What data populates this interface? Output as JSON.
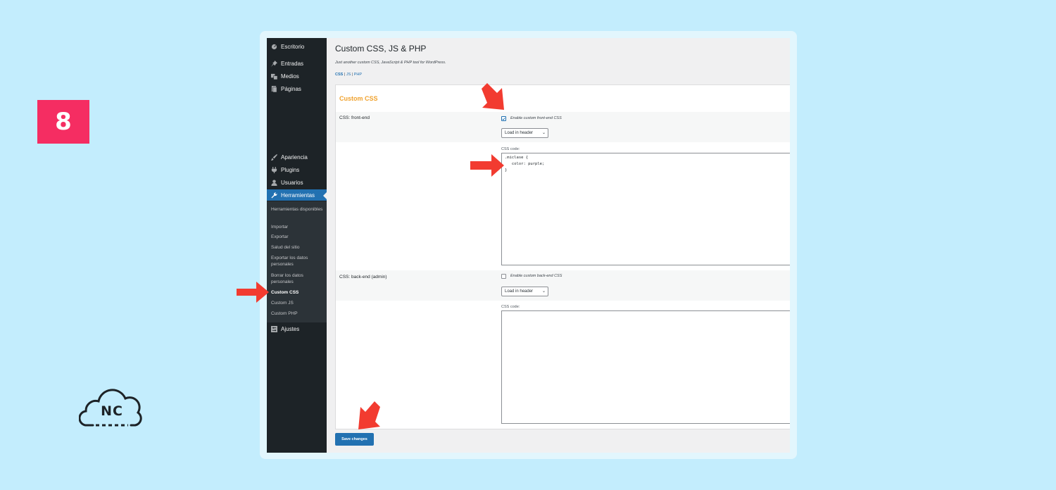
{
  "badge": {
    "step_number": "8"
  },
  "logo": {
    "text": "NC"
  },
  "sidebar": {
    "items": [
      {
        "label": "Escritorio",
        "icon": "dashboard-icon"
      },
      {
        "label": "Entradas",
        "icon": "pin-icon"
      },
      {
        "label": "Medios",
        "icon": "media-icon"
      },
      {
        "label": "Páginas",
        "icon": "pages-icon"
      },
      {
        "label": "Apariencia",
        "icon": "brush-icon"
      },
      {
        "label": "Plugins",
        "icon": "plugin-icon"
      },
      {
        "label": "Usuarios",
        "icon": "user-icon"
      },
      {
        "label": "Herramientas",
        "icon": "wrench-icon",
        "active": true
      },
      {
        "label": "Ajustes",
        "icon": "settings-icon"
      }
    ],
    "submenu": [
      "Herramientas disponibles",
      "Importar",
      "Exportar",
      "Salud del sitio",
      "Exportar los datos personales",
      "Borrar los datos personales",
      "Custom CSS",
      "Custom JS",
      "Custom PHP"
    ]
  },
  "main": {
    "title": "Custom CSS, JS & PHP",
    "description": "Just another custom CSS, JavaScript & PHP tool for WordPress.",
    "links": {
      "css": "CSS",
      "js": "JS",
      "php": "PHP",
      "separator": "|"
    },
    "section_title": "Custom CSS",
    "frontend": {
      "label": "CSS: front-end",
      "checkbox_label": "Enable custom front-end CSS",
      "checked": true,
      "select_value": "Load in header",
      "code_label": "CSS code:",
      "code": ".miclase {\n   color: purple;\n}"
    },
    "backend": {
      "label": "CSS: back-end (admin)",
      "checkbox_label": "Enable custom back-end CSS",
      "checked": false,
      "select_value": "Load in header",
      "code_label": "CSS code:",
      "code": ""
    },
    "save_label": "Save changes"
  },
  "colors": {
    "background": "#c3edfd",
    "badge": "#f52d62",
    "admin_sidebar": "#1d2327",
    "accent": "#2271b1",
    "section_title": "#f0a22e",
    "annotation_arrow": "#f23b30"
  }
}
